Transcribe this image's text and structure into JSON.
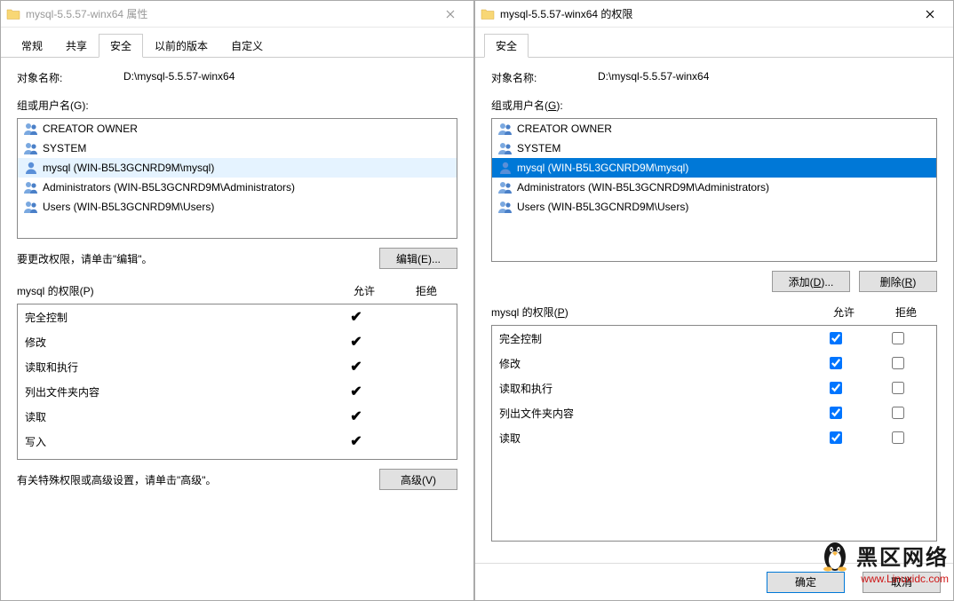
{
  "left": {
    "title": "mysql-5.5.57-winx64 属性",
    "tabs": [
      "常规",
      "共享",
      "安全",
      "以前的版本",
      "自定义"
    ],
    "active_tab": 2,
    "object_label": "对象名称:",
    "object_value": "D:\\mysql-5.5.57-winx64",
    "group_label": "组或用户名(G):",
    "users": [
      "CREATOR OWNER",
      "SYSTEM",
      "mysql (WIN-B5L3GCNRD9M\\mysql)",
      "Administrators (WIN-B5L3GCNRD9M\\Administrators)",
      "Users (WIN-B5L3GCNRD9M\\Users)"
    ],
    "highlight_index": 2,
    "edit_hint": "要更改权限，请单击\"编辑\"。",
    "edit_btn": "编辑(E)...",
    "perm_label": "mysql 的权限(P)",
    "allow_col": "允许",
    "deny_col": "拒绝",
    "perms": [
      {
        "name": "完全控制",
        "allow": true,
        "deny": false
      },
      {
        "name": "修改",
        "allow": true,
        "deny": false
      },
      {
        "name": "读取和执行",
        "allow": true,
        "deny": false
      },
      {
        "name": "列出文件夹内容",
        "allow": true,
        "deny": false
      },
      {
        "name": "读取",
        "allow": true,
        "deny": false
      },
      {
        "name": "写入",
        "allow": true,
        "deny": false
      }
    ],
    "adv_hint": "有关特殊权限或高级设置，请单击\"高级\"。",
    "adv_btn": "高级(V)"
  },
  "right": {
    "title": "mysql-5.5.57-winx64 的权限",
    "tabs": [
      "安全"
    ],
    "active_tab": 0,
    "object_label": "对象名称:",
    "object_value": "D:\\mysql-5.5.57-winx64",
    "group_label_pre": "组或用户名(",
    "group_label_u": "G",
    "group_label_post": "):",
    "users": [
      "CREATOR OWNER",
      "SYSTEM",
      "mysql (WIN-B5L3GCNRD9M\\mysql)",
      "Administrators (WIN-B5L3GCNRD9M\\Administrators)",
      "Users (WIN-B5L3GCNRD9M\\Users)"
    ],
    "selected_index": 2,
    "add_btn_pre": "添加(",
    "add_btn_u": "D",
    "add_btn_post": ")...",
    "remove_btn_pre": "删除(",
    "remove_btn_u": "R",
    "remove_btn_post": ")",
    "perm_label_pre": "mysql 的权限(",
    "perm_label_u": "P",
    "perm_label_post": ")",
    "allow_col": "允许",
    "deny_col": "拒绝",
    "perms": [
      {
        "name": "完全控制",
        "allow": true,
        "deny": false
      },
      {
        "name": "修改",
        "allow": true,
        "deny": false
      },
      {
        "name": "读取和执行",
        "allow": true,
        "deny": false
      },
      {
        "name": "列出文件夹内容",
        "allow": true,
        "deny": false
      },
      {
        "name": "读取",
        "allow": true,
        "deny": false
      }
    ],
    "ok_btn": "确定",
    "cancel_btn": "取消"
  },
  "watermark": {
    "text": "黑区网络",
    "url": "www.Linuxidc.com"
  }
}
